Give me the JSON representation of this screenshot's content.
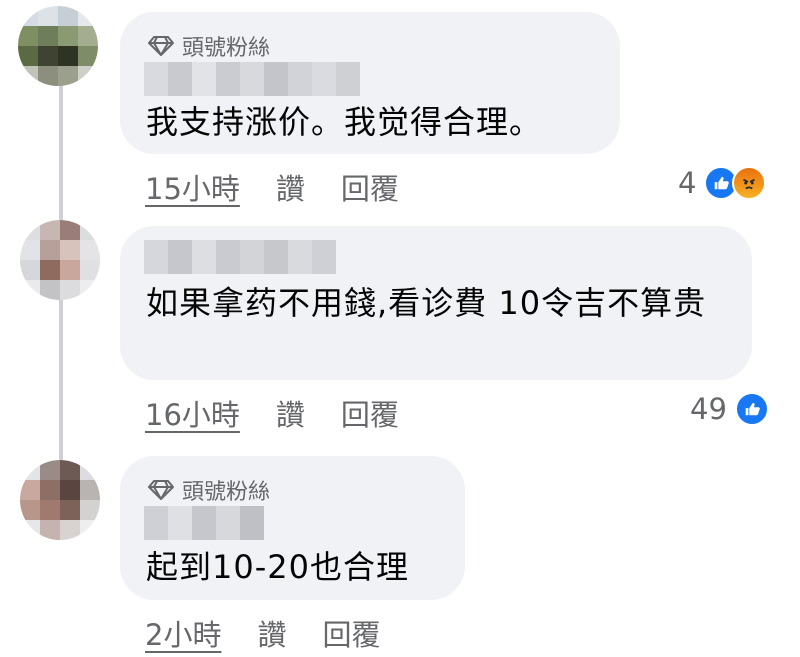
{
  "comments": [
    {
      "badge": "頭號粉絲",
      "text": "我支持涨价。我觉得合理。",
      "time": "15小時",
      "like_label": "讚",
      "reply_label": "回覆",
      "reaction_count": "4",
      "reactions": [
        "like-icon",
        "angry-icon"
      ]
    },
    {
      "text": "如果拿药不用錢,看诊費 10令吉不算贵",
      "time": "16小時",
      "like_label": "讚",
      "reply_label": "回覆",
      "reaction_count": "49",
      "reactions": [
        "like-icon"
      ]
    },
    {
      "badge": "頭號粉絲",
      "text": "起到10-20也合理",
      "time": "2小時",
      "like_label": "讚",
      "reply_label": "回覆"
    }
  ],
  "colors": {
    "bubble": "#f0f2f5",
    "meta_text": "#65676b",
    "like_blue": "#1877f2",
    "angry_orange": "#e9710f"
  }
}
